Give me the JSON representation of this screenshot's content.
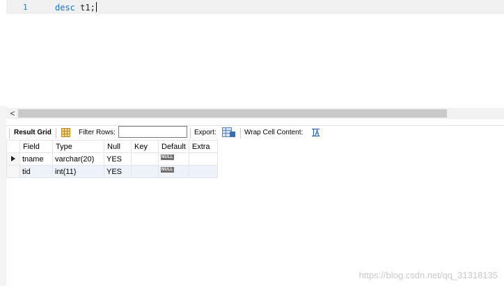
{
  "editor": {
    "line_number": "1",
    "keyword": "desc",
    "code_rest": " t1;"
  },
  "toolbar": {
    "result_grid_label": "Result Grid",
    "filter_rows_label": "Filter Rows:",
    "filter_rows_value": "",
    "export_label": "Export:",
    "wrap_label": "Wrap Cell Content:"
  },
  "grid": {
    "columns": [
      "Field",
      "Type",
      "Null",
      "Key",
      "Default",
      "Extra"
    ],
    "rows": [
      {
        "field": "tname",
        "type": "varchar(20)",
        "null": "YES",
        "key": "",
        "default": "NULL",
        "extra": ""
      },
      {
        "field": "tid",
        "type": "int(11)",
        "null": "YES",
        "key": "",
        "default": "NULL",
        "extra": ""
      }
    ]
  },
  "scrollbar": {
    "left_arrow": "<"
  },
  "watermark": "https://blog.csdn.net/qq_31318135",
  "colors": {
    "keyword": "#1f6fbf",
    "alt_row": "#eef2fb",
    "null_badge": "#6f6f6f"
  }
}
